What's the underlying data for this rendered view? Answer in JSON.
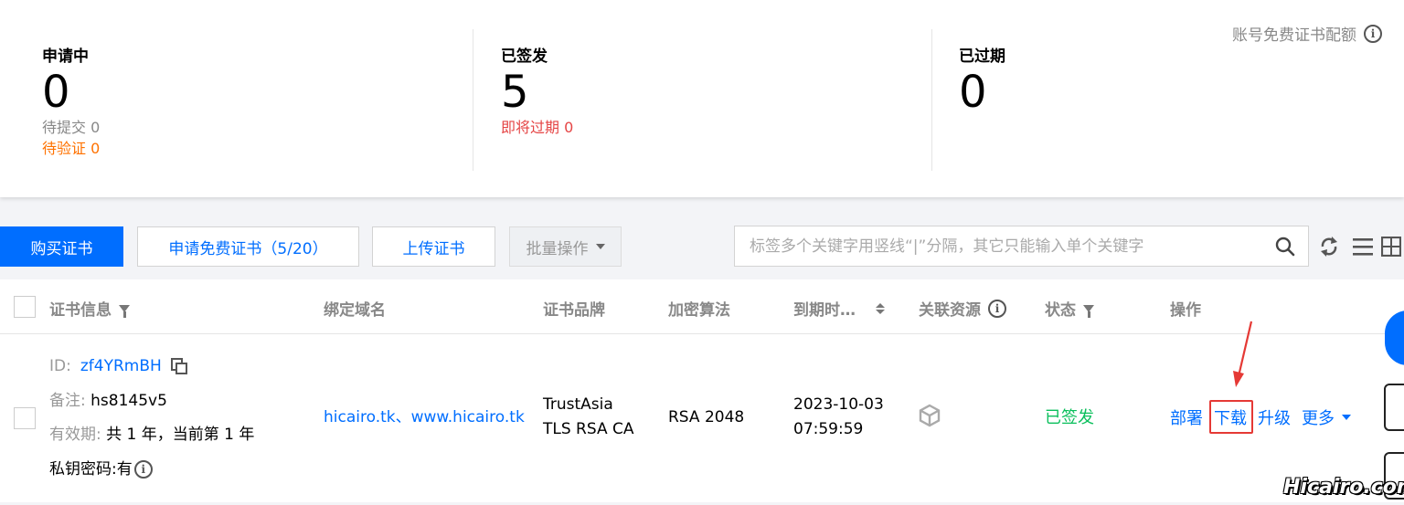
{
  "stats": {
    "pending": {
      "title": "申请中",
      "value": "0",
      "sub1": "待提交 0",
      "sub2": "待验证 0"
    },
    "issued": {
      "title": "已签发",
      "value": "5",
      "sub1": "即将过期 0"
    },
    "expired": {
      "title": "已过期",
      "value": "0"
    },
    "quota_label": "账号免费证书配额"
  },
  "toolbar": {
    "buy_label": "购买证书",
    "apply_free_label": "申请免费证书（5/20）",
    "upload_label": "上传证书",
    "batch_label": "批量操作",
    "search_placeholder": "标签多个关键字用竖线“|”分隔，其它只能输入单个关键字"
  },
  "table": {
    "headers": {
      "cert_info": "证书信息",
      "domain": "绑定域名",
      "brand": "证书品牌",
      "algorithm": "加密算法",
      "expiry": "到期时…",
      "resources": "关联资源",
      "status": "状态",
      "actions": "操作"
    },
    "rows": [
      {
        "id_label": "ID:",
        "id": "zf4YRmBH",
        "remark_label": "备注:",
        "remark": "hs8145v5",
        "validity_label": "有效期:",
        "validity": "共 1 年，当前第 1 年",
        "private_key_label": "私钥密码:",
        "private_key": "有",
        "domain": "hicairo.tk、www.hicairo.tk",
        "brand_line1": "TrustAsia",
        "brand_line2": "TLS RSA CA",
        "algorithm": "RSA 2048",
        "expiry_date": "2023-10-03",
        "expiry_time": "07:59:59",
        "status": "已签发",
        "actions": {
          "deploy": "部署",
          "download": "下载",
          "upgrade": "升级",
          "more": "更多"
        }
      }
    ]
  },
  "watermark": "Hicairo.com",
  "colors": {
    "primary": "#006eff",
    "success": "#0abf5b",
    "warning": "#ff7200",
    "danger": "#e54545",
    "highlight": "#e53935"
  }
}
